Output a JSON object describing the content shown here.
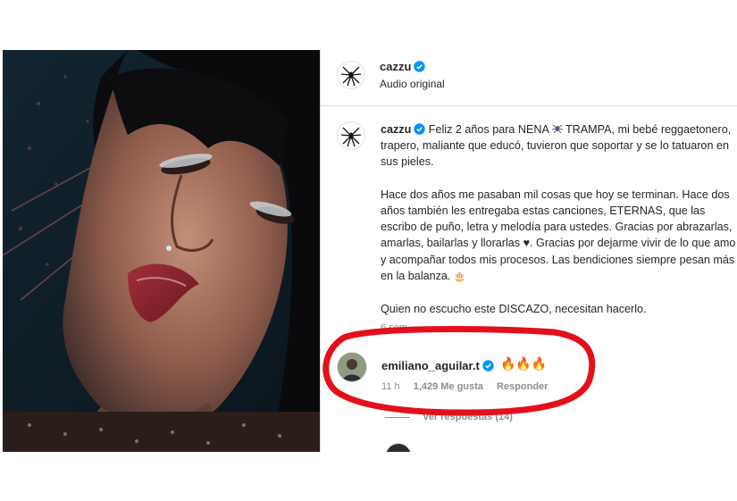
{
  "post": {
    "author": {
      "username": "cazzu",
      "subtitle": "Audio original"
    },
    "caption": {
      "username": "cazzu",
      "text_before_icon": "Feliz 2 años para NENA ",
      "text_after_icon": " TRAMPA, mi bebé reggaetonero, trapero, maliante que educó, tuvieron que soportar y se lo tatuaron en sus pieles.",
      "paragraph2_before_heart": "Hace dos años me pasaban mil cosas que hoy se terminan. Hace dos años también les entregaba estas canciones, ETERNAS, que las escribo de puño, letra y melodía para ustedes. Gracias por abrazarlas, amarlas, bailarlas y llorarlas ",
      "heart": "♥",
      "paragraph2_after_heart": ". Gracias por dejarme vivir de lo que amo y acompañar todos mis procesos. Las bendiciones siempre pesan más en la balanza. ",
      "cake": "🎂",
      "paragraph3": "Quien no escucho este DISCAZO, necesitan hacerlo."
    },
    "time_ago": "6 sem"
  },
  "comment": {
    "username": "emiliano_aguilar.t",
    "text": "🔥🔥🔥",
    "time": "11 h",
    "likes": "1,429 Me gusta",
    "reply_label": "Responder",
    "view_replies": "Ver respuestas (14)"
  },
  "colors": {
    "verified_blue": "#0095f6",
    "highlight_red": "#e3101a",
    "muted_text": "#8e8e8e",
    "divider": "#dbdbdb"
  }
}
